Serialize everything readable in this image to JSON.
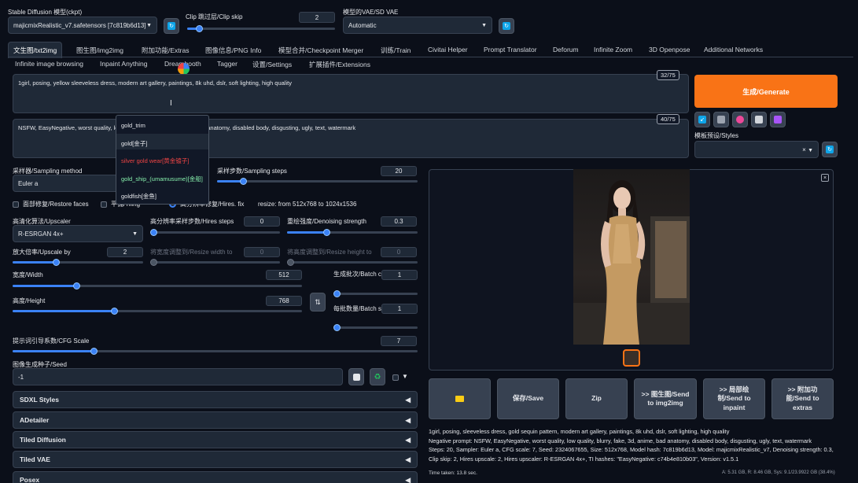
{
  "header": {
    "checkpoint_label": "Stable Diffusion 模型(ckpt)",
    "checkpoint_value": "majicmixRealistic_v7.safetensors [7c819b6d13]",
    "clip_label": "Clip 跳过层/Clip skip",
    "clip_value": "2",
    "clip_fraction": 0.08,
    "vae_label": "模型的VAE/SD VAE",
    "vae_value": "Automatic"
  },
  "tabs_row1": [
    "文生图/txt2img",
    "图生图/img2img",
    "附加功能/Extras",
    "图像信息/PNG Info",
    "模型合并/Checkpoint Merger",
    "训练/Train",
    "Civitai Helper",
    "Prompt Translator",
    "Deforum",
    "Infinite Zoom",
    "3D Openpose",
    "Additional Networks"
  ],
  "tabs_row2": [
    "Infinite image browsing",
    "Inpaint Anything",
    "Dreambooth",
    "Tagger",
    "设置/Settings",
    "扩展插件/Extensions"
  ],
  "prompt": {
    "positive": "1girl, posing, yellow sleeveless dress, modern art gallery, paintings, 8k uhd, dslr, soft lighting, high quality",
    "positive_count": "32/75",
    "negative_start": "NSFW, EasyNegative, worst quality, lo",
    "negative_end": "d anatomy, disabled body, disgusting, ugly, text, watermark",
    "negative_count": "40/75"
  },
  "autocomplete": [
    {
      "text": "gold_trim",
      "color": "#e5e7eb"
    },
    {
      "text": "gold[金子]",
      "color": "#e5e7eb"
    },
    {
      "text": "silver gold wear[黄金镀子]",
      "color": "#ef4444"
    },
    {
      "text": "gold_ship_(umamusume)[金船]",
      "color": "#86efac"
    },
    {
      "text": "goldfish[金鱼]",
      "color": "#e5e7eb"
    }
  ],
  "generate": {
    "label": "生成/Generate",
    "styles_label": "模板预设/Styles",
    "styles_clear": "×"
  },
  "sampling": {
    "method_label": "采样器/Sampling method",
    "method_value": "Euler a",
    "steps_label": "采样步数/Sampling steps",
    "steps_value": "20",
    "steps_fraction": 0.13
  },
  "options": {
    "restore_faces": "面部修复/Restore faces",
    "tiling": "平铺/Tiling",
    "hires_fix": "高分辨率修复/Hires. fix",
    "resize_info": "resize: from 512x768 to 1024x1536"
  },
  "hires": {
    "upscaler_label": "高清化算法/Upscaler",
    "upscaler_value": "R-ESRGAN 4x+",
    "steps_label": "高分辨率采样步数/Hires steps",
    "steps_value": "0",
    "steps_fraction": 0.0,
    "denoise_label": "重绘强度/Denoising strength",
    "denoise_value": "0.3",
    "denoise_fraction": 0.3,
    "upscale_label": "放大倍率/Upscale by",
    "upscale_value": "2",
    "upscale_fraction": 0.33,
    "resize_w_label": "将宽度调整到/Resize width to",
    "resize_w_value": "0",
    "resize_h_label": "将高度调整到/Resize height to",
    "resize_h_value": "0"
  },
  "size": {
    "width_label": "宽度/Width",
    "width_value": "512",
    "width_fraction": 0.22,
    "height_label": "高度/Height",
    "height_value": "768",
    "height_fraction": 0.35,
    "batch_count_label": "生成批次/Batch count",
    "batch_count_value": "1",
    "batch_size_label": "每批数量/Batch size",
    "batch_size_value": "1"
  },
  "cfg": {
    "label": "提示词引导系数/CFG Scale",
    "value": "7",
    "fraction": 0.2
  },
  "seed": {
    "label": "图像生成种子/Seed",
    "value": "-1"
  },
  "accordions": [
    "SDXL Styles",
    "ADetailer",
    "Tiled Diffusion",
    "Tiled VAE",
    "Posex"
  ],
  "actions": [
    {
      "label": "📁",
      "name": "open-folder-button"
    },
    {
      "label": "保存/Save",
      "name": "save-button"
    },
    {
      "label": "Zip",
      "name": "zip-button"
    },
    {
      "label": ">> 图生图/Send to img2img",
      "name": "send-to-img2img-button"
    },
    {
      "label": ">> 局部绘制/Send to inpaint",
      "name": "send-to-inpaint-button"
    },
    {
      "label": ">> 附加功能/Send to extras",
      "name": "send-to-extras-button"
    }
  ],
  "info": {
    "line1": "1girl, posing, sleeveless dress, gold sequin pattern, modern art gallery, paintings, 8k uhd, dslr, soft lighting, high quality",
    "line2": "Negative prompt: NSFW, EasyNegative, worst quality, low quality, blurry, fake, 3d, anime, bad anatomy, disabled body, disgusting, ugly, text, watermark",
    "line3": "Steps: 20, Sampler: Euler a, CFG scale: 7, Seed: 2324067655, Size: 512x768, Model hash: 7c819b6d13, Model: majicmixRealistic_v7, Denoising strength: 0.3,",
    "line4": "Clip skip: 2, Hires upscale: 2, Hires upscaler: R-ESRGAN 4x+, TI hashes: \"EasyNegative: c74b4e810b03\", Version: v1.5.1",
    "time": "Time taken: 13.8 sec.",
    "memory": "A: 5.31 GB, R: 8.46 GB, Sys: 9.1/23.9922 GB (38.4%)"
  },
  "colors": {
    "background": "#0b0f19",
    "generate": "#f97316",
    "accent": "#3b82f6"
  }
}
